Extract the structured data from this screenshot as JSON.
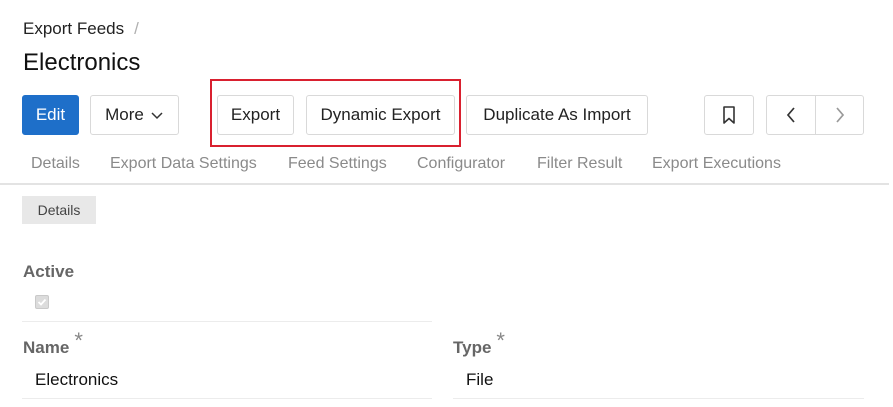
{
  "breadcrumb": {
    "parent": "Export Feeds",
    "separator": "/"
  },
  "page": {
    "title": "Electronics"
  },
  "toolbar": {
    "edit_label": "Edit",
    "more_label": "More",
    "export_label": "Export",
    "dynamic_export_label": "Dynamic Export",
    "duplicate_label": "Duplicate As Import"
  },
  "tabs": [
    {
      "label": "Details"
    },
    {
      "label": "Export Data Settings"
    },
    {
      "label": "Feed Settings"
    },
    {
      "label": "Configurator"
    },
    {
      "label": "Filter Result"
    },
    {
      "label": "Export Executions"
    }
  ],
  "section": {
    "title": "Details"
  },
  "fields": {
    "active": {
      "label": "Active",
      "checked": true
    },
    "name": {
      "label": "Name",
      "required_mark": "*",
      "value": "Electronics"
    },
    "type": {
      "label": "Type",
      "required_mark": "*",
      "value": "File"
    }
  },
  "colors": {
    "primary": "#1e6fc9",
    "highlight": "#d9202f"
  }
}
